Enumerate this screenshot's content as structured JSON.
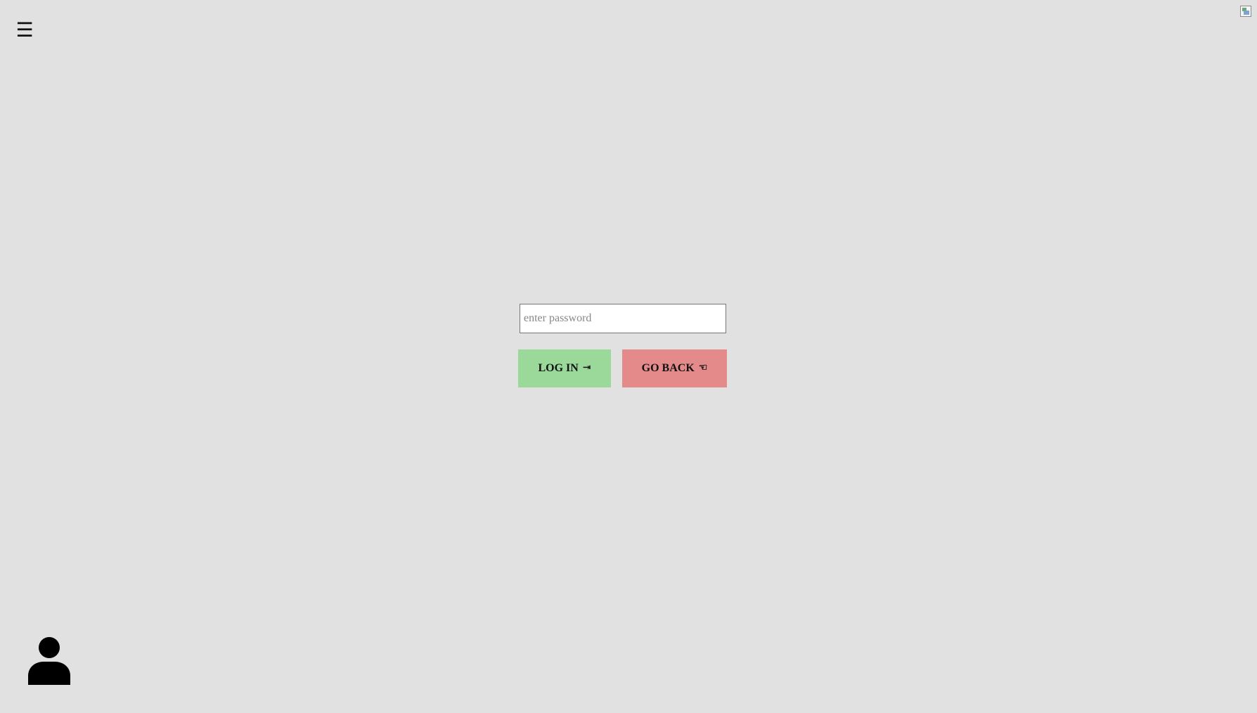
{
  "nav": {
    "menu_icon": "☰"
  },
  "form": {
    "password_placeholder": "enter password",
    "password_value": "",
    "login_label": "LOG IN",
    "login_icon": "⇥",
    "back_label": "GO BACK",
    "back_icon": "☜"
  },
  "colors": {
    "background": "#e1e1e1",
    "login_button": "#9bd99a",
    "back_button": "#e48a8a"
  }
}
